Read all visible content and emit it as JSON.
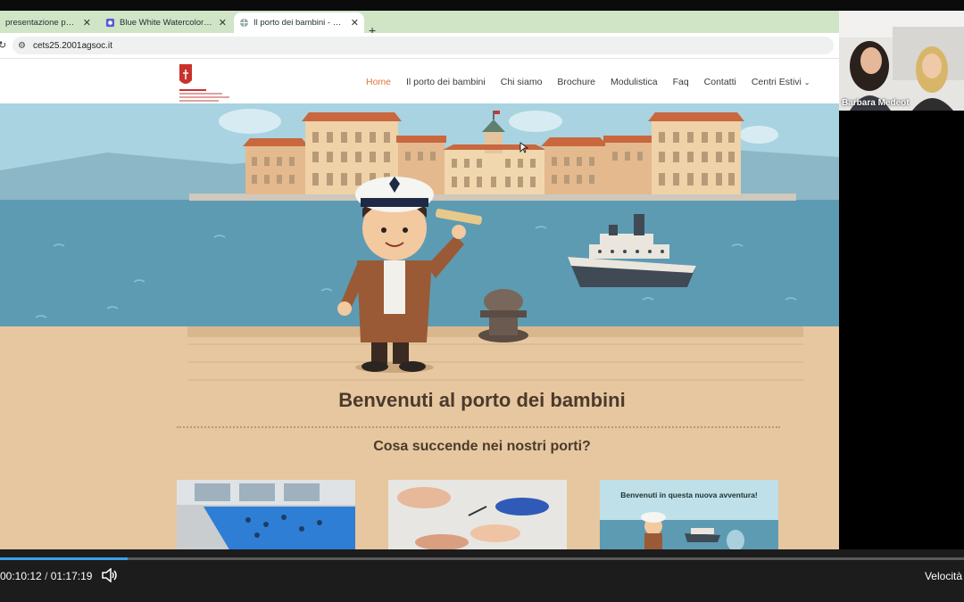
{
  "browser": {
    "tabs": [
      {
        "label": "presentazione per riunion",
        "active": false
      },
      {
        "label": "Blue White Watercolor Marine F",
        "active": false
      },
      {
        "label": "Il porto dei bambini - Centri Esti",
        "active": true
      }
    ],
    "url": "cets25.2001agsoc.it"
  },
  "site": {
    "nav": [
      "Home",
      "Il porto dei bambini",
      "Chi siamo",
      "Brochure",
      "Modulistica",
      "Faq",
      "Contatti",
      "Centri Estivi"
    ],
    "active_nav": "Home",
    "hero_title": "Benvenuti al porto dei bambini",
    "subtitle": "Cosa succende nei nostri porti?",
    "card3_caption": "Benvenuti in questa nuova avventura!",
    "accent_color": "#e0753a"
  },
  "video": {
    "current_time": "00:10:12",
    "separator": "/",
    "duration": "01:17:19",
    "speed_label": "Velocità",
    "progress_fraction": 0.132
  },
  "webcam": {
    "participant_name": "Barbara Medeot"
  }
}
